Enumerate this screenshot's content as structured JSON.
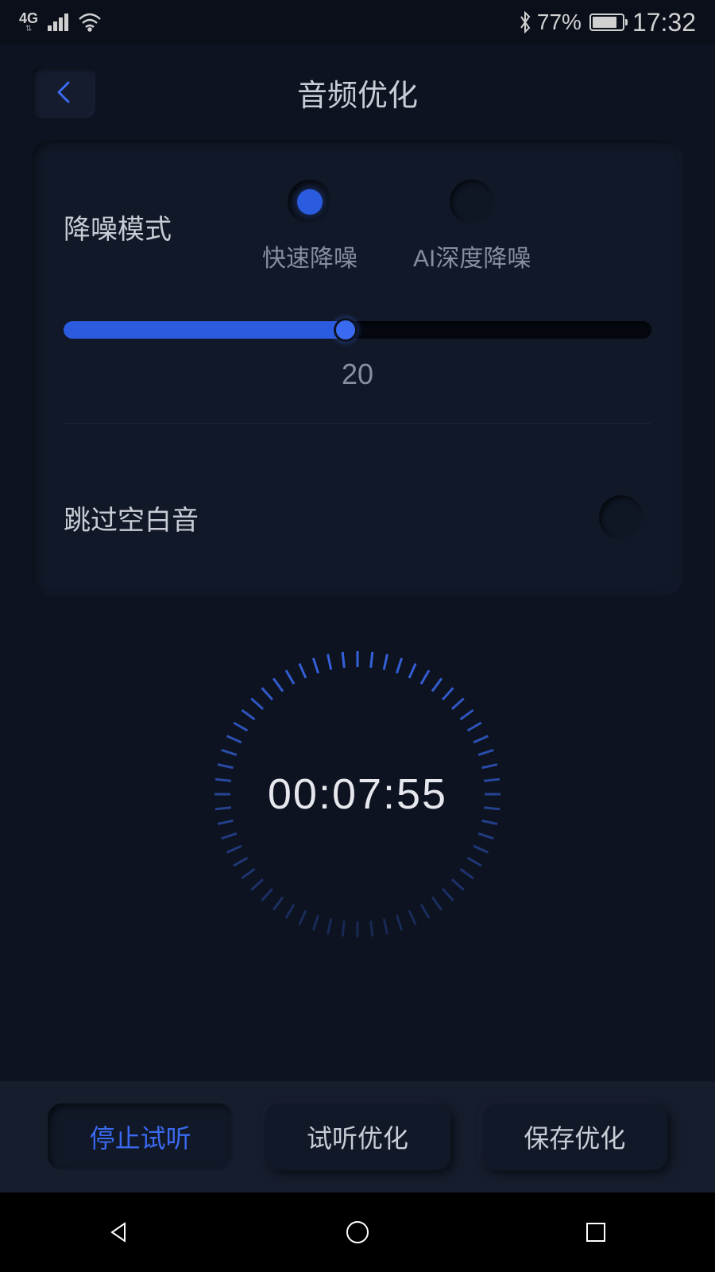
{
  "statusbar": {
    "network": "4G",
    "battery_pct": "77%",
    "time": "17:32"
  },
  "header": {
    "title": "音频优化"
  },
  "noise": {
    "label": "降噪模式",
    "options": {
      "fast": "快速降噪",
      "ai": "AI深度降噪"
    },
    "slider_value": "20",
    "slider_percent": 48
  },
  "skip": {
    "label": "跳过空白音"
  },
  "timer": {
    "display": "00:07:55"
  },
  "buttons": {
    "stop": "停止试听",
    "preview": "试听优化",
    "save": "保存优化"
  },
  "icons": {
    "bluetooth": "bluetooth-icon",
    "wifi": "wifi-icon"
  }
}
